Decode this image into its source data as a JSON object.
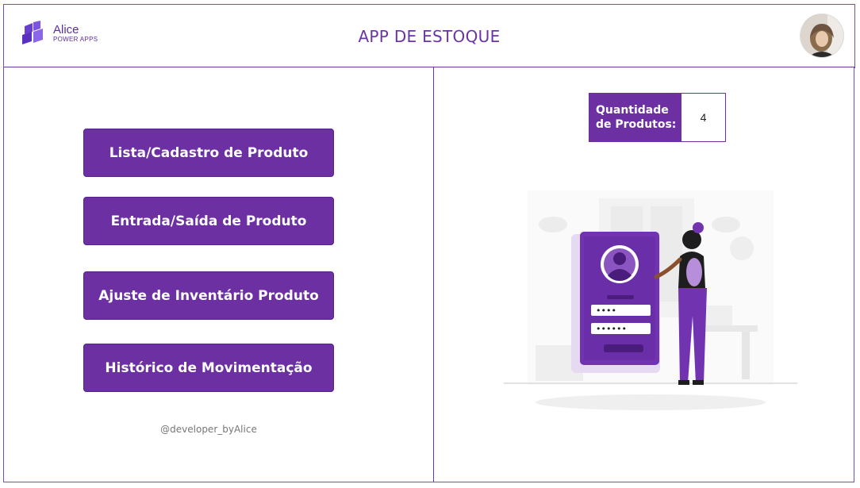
{
  "header": {
    "logo": {
      "name": "Alice",
      "subtitle": "POWER APPS"
    },
    "title": "APP DE ESTOQUE"
  },
  "menu": {
    "buttons": [
      {
        "label": "Lista/Cadastro de Produto"
      },
      {
        "label": "Entrada/Saída de Produto"
      },
      {
        "label": "Ajuste de Inventário Produto"
      },
      {
        "label": "Histórico de Movimentação"
      }
    ],
    "credit": "@developer_byAlice"
  },
  "stats": {
    "quantity_label_line1": "Quantidade",
    "quantity_label_line2": "de Produtos:",
    "quantity_value": "4"
  },
  "illustration": {
    "password_short": "••••",
    "password_long": "••••••"
  },
  "colors": {
    "brand_purple": "#6c30a2",
    "border_purple": "#7a4fb0"
  }
}
